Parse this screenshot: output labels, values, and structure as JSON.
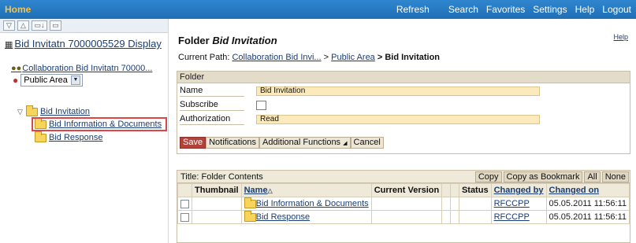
{
  "header": {
    "home": "Home",
    "nav": [
      "Refresh",
      "Search",
      "Favorites",
      "Settings",
      "Help",
      "Logout"
    ]
  },
  "left": {
    "toolbar_icons": [
      "filter-icon",
      "up-icon",
      "new-folder-icon",
      "folder-icon"
    ],
    "title": "Bid Invitatn 7000005529 Display",
    "collab_link": "Collaboration Bid Invitatn 70000...",
    "area_select": "Public Area",
    "tree": [
      {
        "label": "Bid Invitation"
      },
      {
        "label": "Bid Information & Documents"
      },
      {
        "label": "Bid Response"
      }
    ]
  },
  "main": {
    "help": "Help",
    "title_prefix": "Folder ",
    "title_name": "Bid Invitation",
    "path_label": "Current Path:",
    "path_link1": "Collaboration Bid Invi...",
    "path_sep": " > ",
    "path_link2": "Public Area",
    "path_current": " > Bid Invitation",
    "panel": {
      "header": "Folder",
      "name_label": "Name",
      "name_value": "Bid Invitation",
      "subscribe_label": "Subscribe",
      "auth_label": "Authorization",
      "auth_value": "Read",
      "buttons": {
        "save": "Save",
        "notifications": "Notifications",
        "additional": "Additional Functions",
        "cancel": "Cancel"
      }
    },
    "contents": {
      "title": "Title: Folder Contents",
      "actions": [
        "Copy",
        "Copy as Bookmark",
        "All",
        "None"
      ],
      "columns": {
        "thumbnail": "Thumbnail",
        "name": "Name",
        "version": "Current Version",
        "status": "Status",
        "changed_by": "Changed by",
        "changed_on": "Changed on"
      },
      "rows": [
        {
          "name": "Bid Information & Documents",
          "changed_by": "RFCCPP",
          "changed_on": "05.05.2011 11:56:11"
        },
        {
          "name": "Bid Response",
          "changed_by": "RFCCPP",
          "changed_on": "05.05.2011 11:56:11"
        }
      ]
    }
  }
}
